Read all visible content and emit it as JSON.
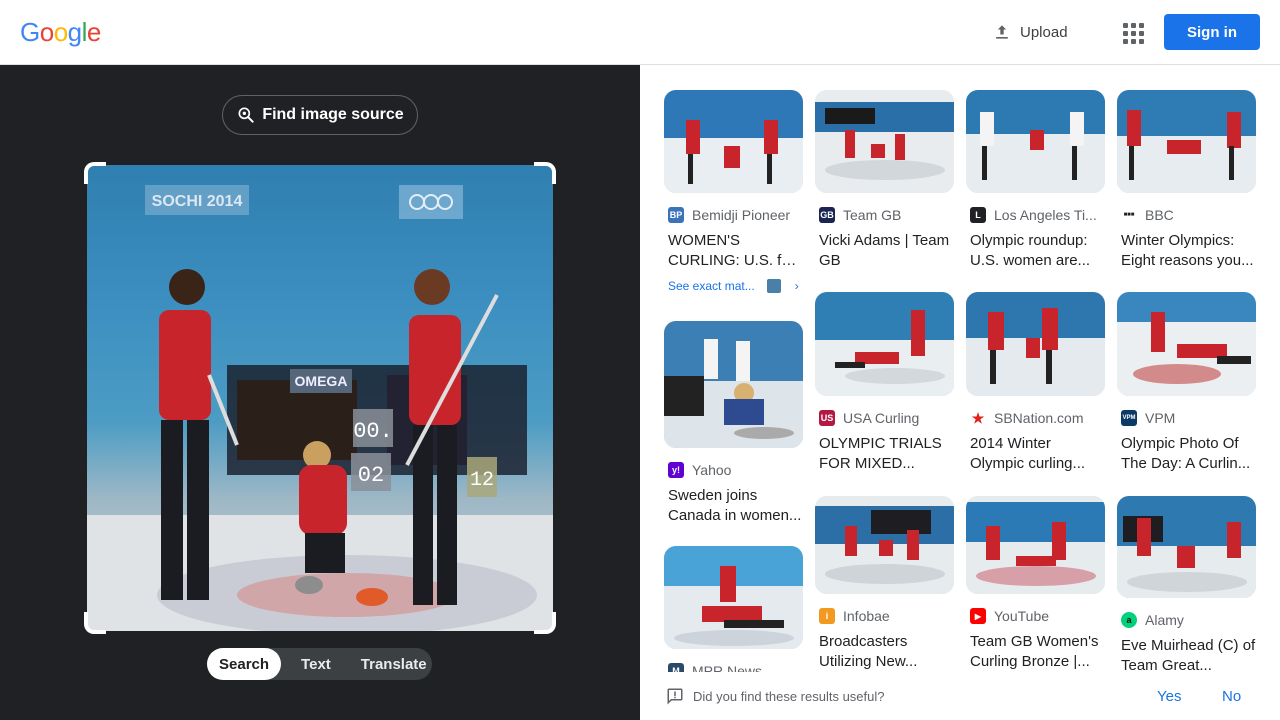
{
  "header": {
    "logo_letters": [
      "G",
      "o",
      "o",
      "g",
      "l",
      "e"
    ],
    "logo_colors": [
      "#4285f4",
      "#ea4335",
      "#fbbc05",
      "#4285f4",
      "#34a853",
      "#ea4335"
    ],
    "upload_label": "Upload",
    "apps_icon": "apps-grid-icon",
    "signin_label": "Sign in"
  },
  "left_panel": {
    "find_source_label": "Find image source",
    "photo_texts": {
      "sochi": "SOCHI 2014",
      "omega": "OMEGA",
      "score_top": "00.",
      "score_bottom": "02",
      "score_side": "12"
    },
    "modes": [
      "Search",
      "Text",
      "Translate"
    ],
    "active_mode": "Search"
  },
  "results": [
    {
      "source": "Bemidji Pioneer",
      "title": "WOMEN'S CURLING: U.S. falls to...",
      "favicon": "BP",
      "fav_color": "#3b73b9",
      "exact": "See exact mat..."
    },
    {
      "source": "Team GB",
      "title": "Vicki Adams | Team GB",
      "favicon": "GB",
      "fav_color": "#1b2452"
    },
    {
      "source": "Los Angeles Ti...",
      "title": "Olympic roundup: U.S. women are...",
      "favicon": "L",
      "fav_color": "#202124"
    },
    {
      "source": "BBC",
      "title": "Winter Olympics: Eight reasons you...",
      "favicon": "■■■",
      "fav_color": "#ffffff"
    },
    {
      "source": "Yahoo",
      "title": "Sweden joins Canada in women...",
      "favicon": "y!",
      "fav_color": "#6001d2"
    },
    {
      "source": "USA Curling",
      "title": "OLYMPIC TRIALS FOR MIXED...",
      "favicon": "US",
      "fav_color": "#b31942"
    },
    {
      "source": "SBNation.com",
      "title": "2014 Winter Olympic curling...",
      "favicon": "★",
      "fav_color": "#ffffff"
    },
    {
      "source": "VPM",
      "title": "Olympic Photo Of The Day: A Curlin...",
      "favicon": "VPM",
      "fav_color": "#0b3a66"
    },
    {
      "source": "MPR News",
      "title": "",
      "favicon": "M",
      "fav_color": "#2a4a6a"
    },
    {
      "source": "Infobae",
      "title": "Broadcasters Utilizing New...",
      "favicon": "i",
      "fav_color": "#f29a1f"
    },
    {
      "source": "YouTube",
      "title": "Team GB Women's Curling Bronze |...",
      "favicon": "▶",
      "fav_color": "#ff0000"
    },
    {
      "source": "Alamy",
      "title": "Eve Muirhead (C) of Team Great...",
      "favicon": "a",
      "fav_color": "#00d17a"
    }
  ],
  "feedback": {
    "question": "Did you find these results useful?",
    "yes": "Yes",
    "no": "No"
  }
}
